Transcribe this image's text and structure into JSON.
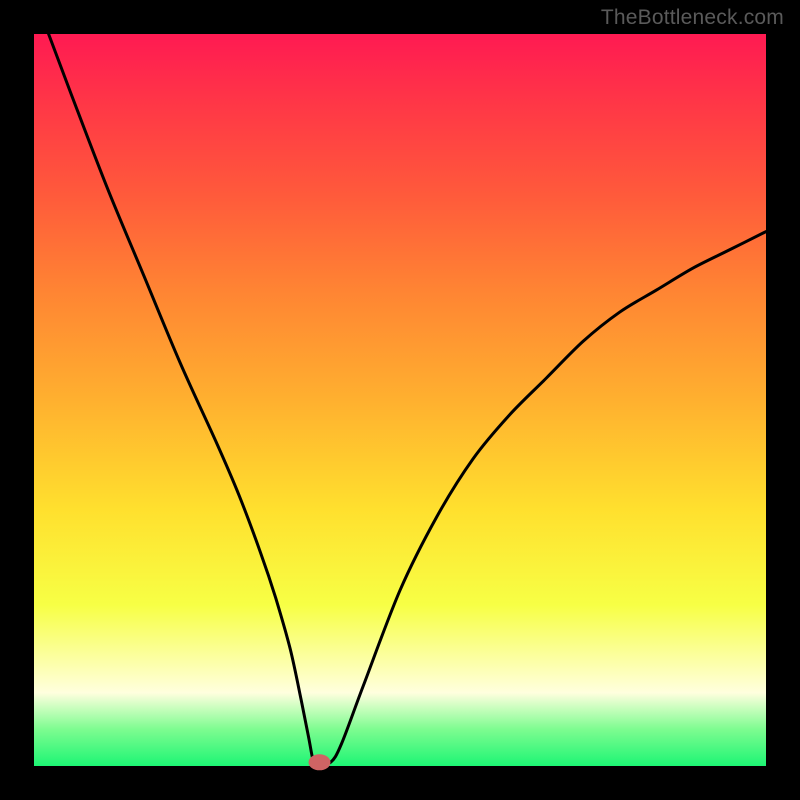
{
  "watermark": "TheBottleneck.com",
  "chart_data": {
    "type": "line",
    "title": "",
    "xlabel": "",
    "ylabel": "",
    "xlim": [
      0,
      100
    ],
    "ylim": [
      0,
      100
    ],
    "grid": false,
    "legend": false,
    "series": [
      {
        "name": "curve",
        "x": [
          2,
          5,
          10,
          15,
          20,
          25,
          28,
          31,
          33,
          35,
          36.5,
          37.5,
          38.2,
          38.8,
          40.5,
          42,
          45,
          50,
          55,
          60,
          65,
          70,
          75,
          80,
          85,
          90,
          95,
          100
        ],
        "values": [
          100,
          92,
          79,
          67,
          55,
          44,
          37,
          29,
          23,
          16,
          9,
          4,
          0.5,
          0.5,
          0.5,
          3,
          11,
          24,
          34,
          42,
          48,
          53,
          58,
          62,
          65,
          68,
          70.5,
          73
        ]
      }
    ],
    "marker": {
      "x": 39,
      "y": 0.5,
      "color": "#cf6464"
    },
    "colors": {
      "curve": "#000000",
      "marker": "#cf6464"
    }
  }
}
